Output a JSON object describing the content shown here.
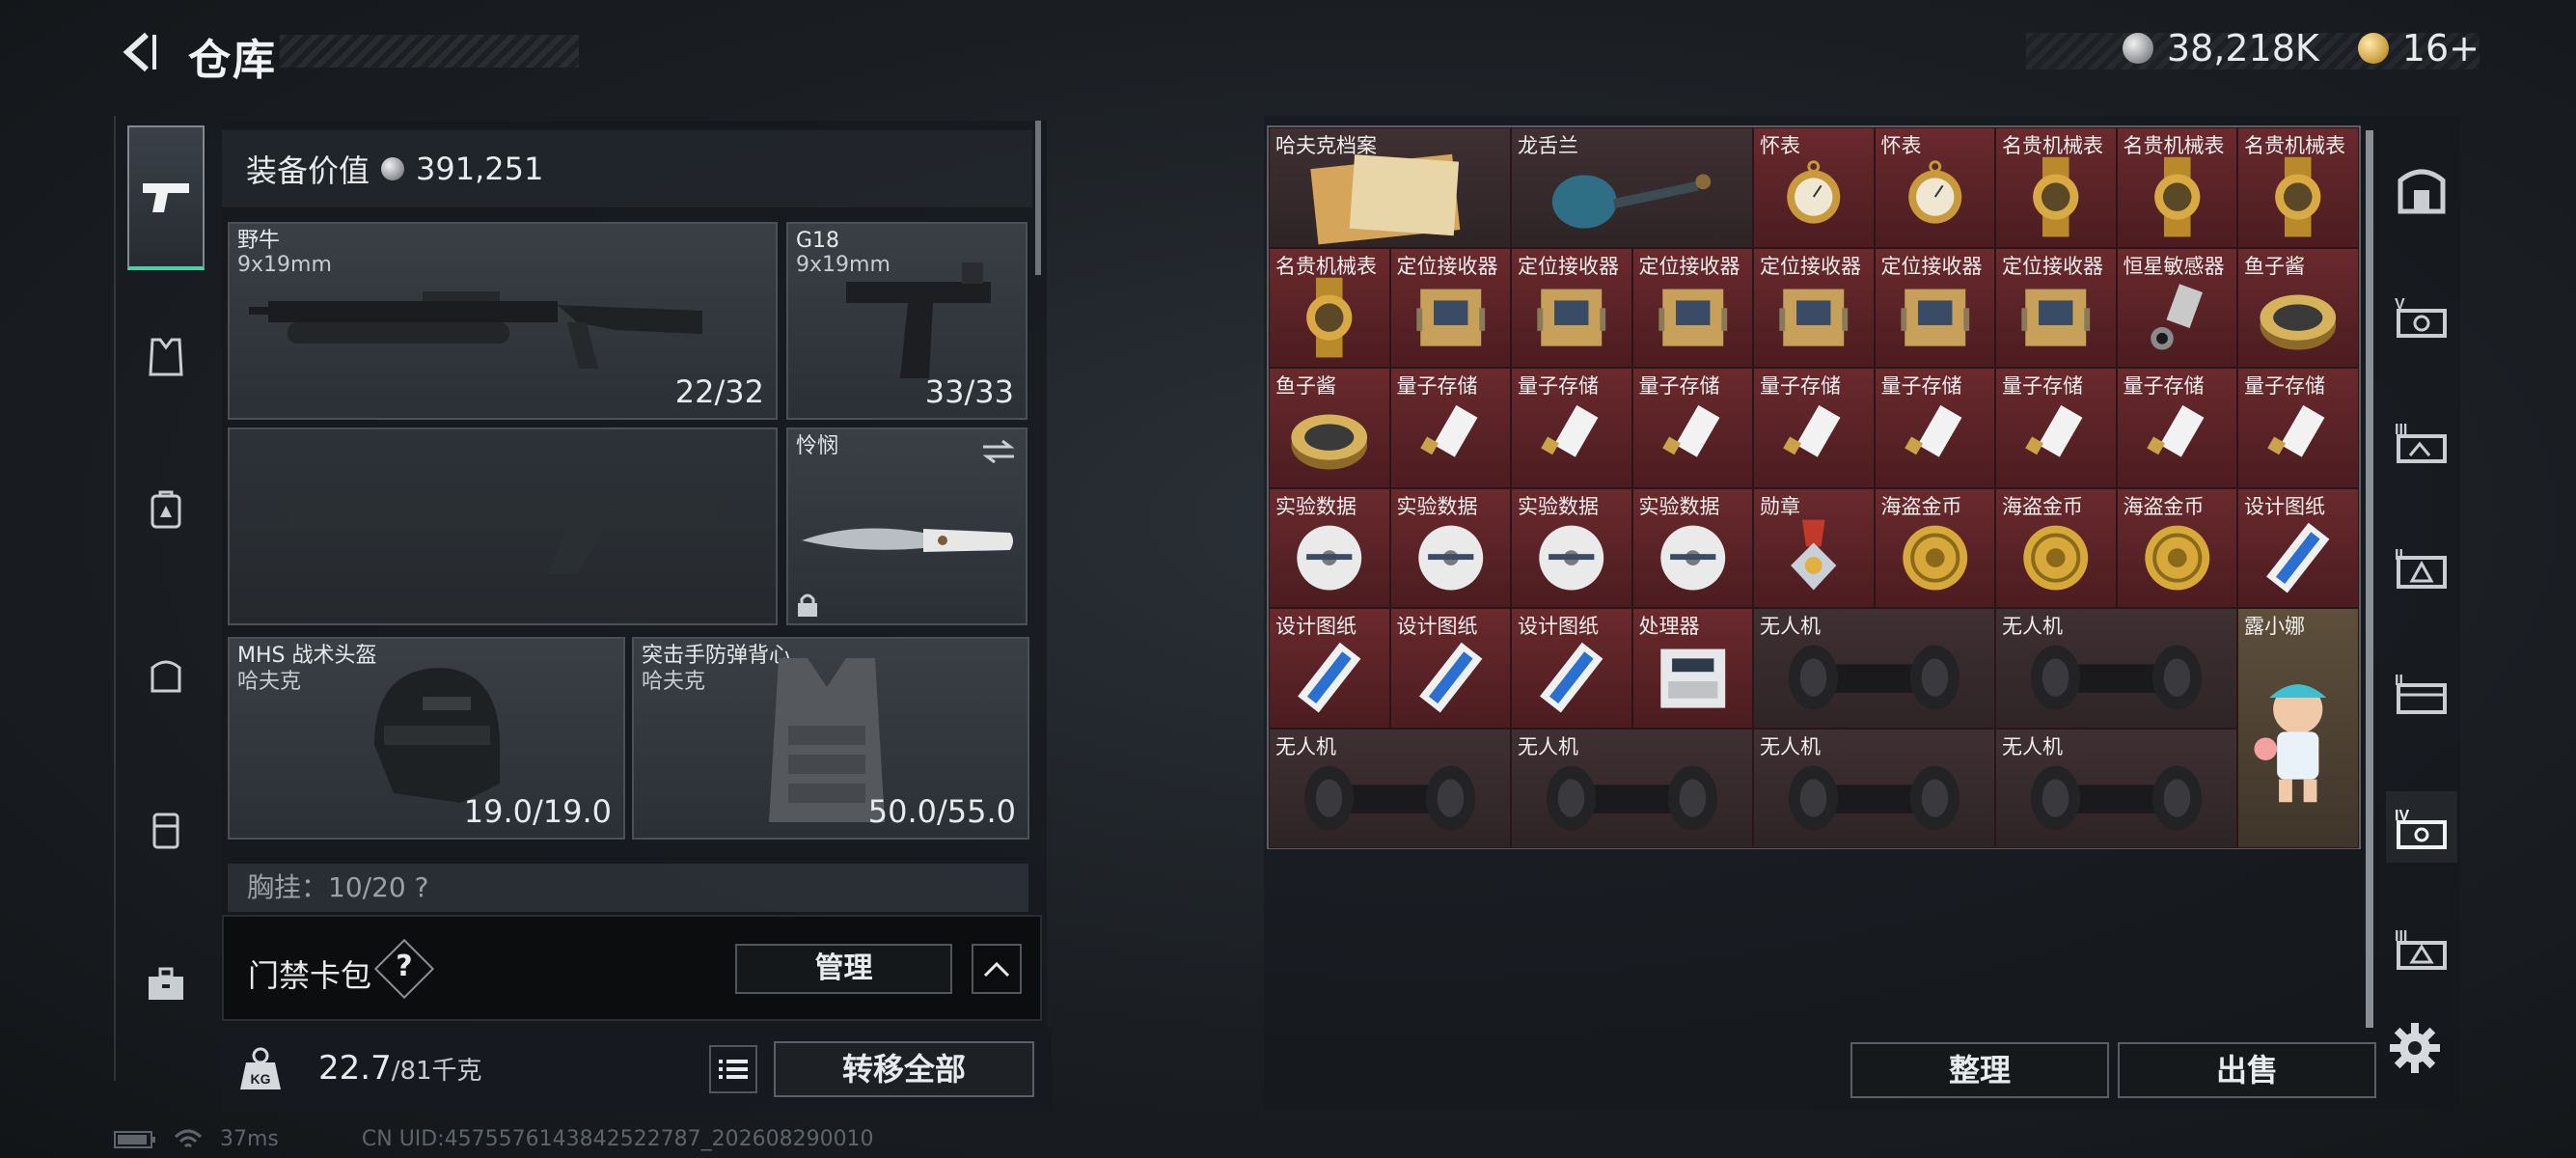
{
  "header": {
    "title": "仓库",
    "currency_primary": "38,218K",
    "currency_secondary": "16+"
  },
  "left_nav": {
    "items": [
      "pistol-icon",
      "armor-icon",
      "backpack-icon",
      "pouch-icon",
      "rig-icon",
      "briefcase-icon"
    ]
  },
  "equipment": {
    "value_label": "装备价值",
    "value": "391,251",
    "primary_weapon": {
      "name": "野牛",
      "ammo": "9x19mm",
      "count": "22/32"
    },
    "sidearm": {
      "name": "G18",
      "ammo": "9x19mm",
      "count": "33/33"
    },
    "melee": {
      "name": "怜悯"
    },
    "helmet": {
      "name": "MHS 战术头盔",
      "brand": "哈夫克",
      "durability": "19.0/19.0"
    },
    "vest": {
      "name": "突击手防弹背心",
      "brand": "哈夫克",
      "durability": "50.0/55.0"
    },
    "chest_rig": "胸挂：10/20 ?"
  },
  "keycard": {
    "label": "门禁卡包",
    "help": "?",
    "manage": "管理"
  },
  "weight": {
    "current": "22.7",
    "capacity": "/81千克",
    "transfer_all": "转移全部"
  },
  "status": {
    "ping": "37ms",
    "uid": "CN UID:4575576143842522787_202608290010"
  },
  "stash": {
    "items": [
      {
        "label": "哈夫克档案",
        "icon": "document-icon"
      },
      {
        "label": "龙舌兰",
        "icon": "bottle-icon"
      },
      {
        "label": "怀表",
        "icon": "pocket-watch-icon"
      },
      {
        "label": "怀表",
        "icon": "pocket-watch-icon"
      },
      {
        "label": "名贵机械表",
        "icon": "watch-icon"
      },
      {
        "label": "名贵机械表",
        "icon": "watch-icon"
      },
      {
        "label": "名贵机械表",
        "icon": "watch-icon"
      },
      {
        "label": "名贵机械表",
        "icon": "watch-icon"
      },
      {
        "label": "定位接收器",
        "icon": "receiver-icon"
      },
      {
        "label": "定位接收器",
        "icon": "receiver-icon"
      },
      {
        "label": "定位接收器",
        "icon": "receiver-icon"
      },
      {
        "label": "定位接收器",
        "icon": "receiver-icon"
      },
      {
        "label": "定位接收器",
        "icon": "receiver-icon"
      },
      {
        "label": "定位接收器",
        "icon": "receiver-icon"
      },
      {
        "label": "恒星敏感器",
        "icon": "sensor-icon"
      },
      {
        "label": "鱼子酱",
        "icon": "caviar-icon"
      },
      {
        "label": "鱼子酱",
        "icon": "caviar-icon"
      },
      {
        "label": "量子存储",
        "icon": "usb-icon"
      },
      {
        "label": "量子存储",
        "icon": "usb-icon"
      },
      {
        "label": "量子存储",
        "icon": "usb-icon"
      },
      {
        "label": "量子存储",
        "icon": "usb-icon"
      },
      {
        "label": "量子存储",
        "icon": "usb-icon"
      },
      {
        "label": "量子存储",
        "icon": "usb-icon"
      },
      {
        "label": "量子存储",
        "icon": "usb-icon"
      },
      {
        "label": "量子存储",
        "icon": "usb-icon"
      },
      {
        "label": "实验数据",
        "icon": "disc-icon"
      },
      {
        "label": "实验数据",
        "icon": "disc-icon"
      },
      {
        "label": "实验数据",
        "icon": "disc-icon"
      },
      {
        "label": "实验数据",
        "icon": "disc-icon"
      },
      {
        "label": "勋章",
        "icon": "medal-icon"
      },
      {
        "label": "海盗金币",
        "icon": "coin-icon"
      },
      {
        "label": "海盗金币",
        "icon": "coin-icon"
      },
      {
        "label": "海盗金币",
        "icon": "coin-icon"
      },
      {
        "label": "设计图纸",
        "icon": "blueprint-icon"
      },
      {
        "label": "设计图纸",
        "icon": "blueprint-icon"
      },
      {
        "label": "设计图纸",
        "icon": "blueprint-icon"
      },
      {
        "label": "设计图纸",
        "icon": "blueprint-icon"
      },
      {
        "label": "处理器",
        "icon": "processor-icon"
      },
      {
        "label": "无人机",
        "icon": "drone-icon"
      },
      {
        "label": "无人机",
        "icon": "drone-icon"
      },
      {
        "label": "露小娜",
        "icon": "figurine-icon"
      },
      {
        "label": "无人机",
        "icon": "drone-icon"
      },
      {
        "label": "无人机",
        "icon": "drone-icon"
      },
      {
        "label": "无人机",
        "icon": "drone-icon"
      },
      {
        "label": "无人机",
        "icon": "drone-icon"
      }
    ],
    "sort": "整理",
    "sell": "出售"
  },
  "right_nav": {
    "items": [
      "safe-icon",
      "stash-v-icon",
      "stash-iii-icon",
      "stash-ii-icon",
      "stash-ii-box-icon",
      "stash-iv-icon",
      "stash-iii-b-icon"
    ]
  }
}
